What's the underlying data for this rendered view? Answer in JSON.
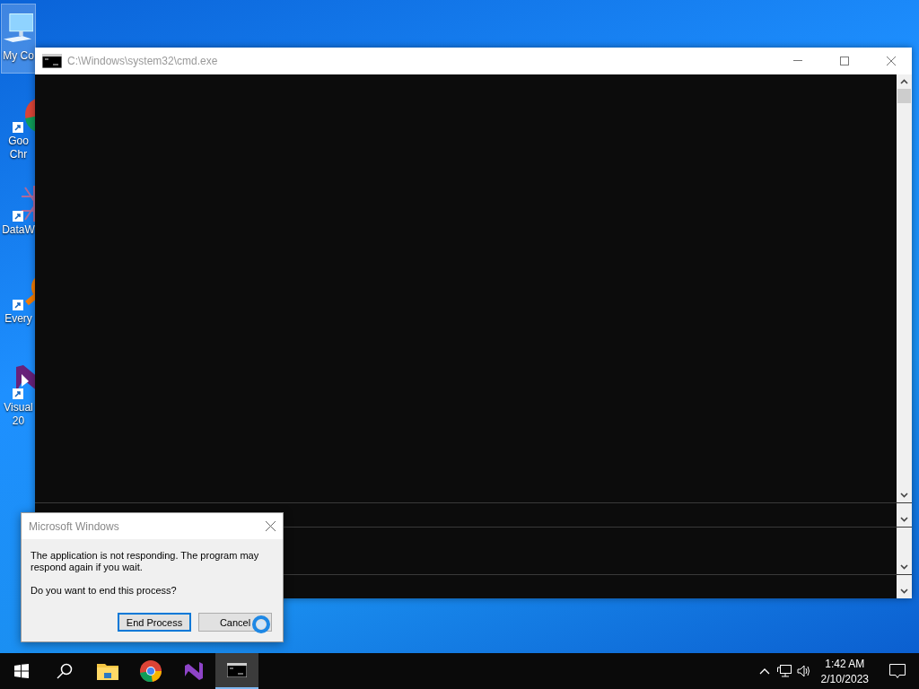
{
  "desktop_icons": [
    {
      "kind": "computer",
      "lines": [
        "My Co"
      ],
      "selected": true
    },
    {
      "kind": "chrome",
      "lines": [
        "Goo",
        "Chr"
      ],
      "selected": false
    },
    {
      "kind": "grid",
      "lines": [
        "DataW"
      ],
      "selected": false
    },
    {
      "kind": "magnifier",
      "lines": [
        "Every"
      ],
      "selected": false
    },
    {
      "kind": "studio",
      "lines": [
        "Visual",
        "20"
      ],
      "selected": false
    }
  ],
  "window": {
    "title": "C:\\Windows\\system32\\cmd.exe"
  },
  "dialog": {
    "title": "Microsoft Windows",
    "message": "The application is not responding. The program may respond again if you wait.",
    "question": "Do you want to end this process?",
    "buttons": [
      {
        "label": "End Process",
        "focused": true
      },
      {
        "label": "Cancel",
        "focused": false
      }
    ]
  },
  "taskbar": {
    "apps": [
      {
        "kind": "explorer",
        "active": false
      },
      {
        "kind": "chrome",
        "active": false
      },
      {
        "kind": "studio",
        "active": false
      },
      {
        "kind": "console",
        "active": true
      }
    ],
    "time": "1:42 AM",
    "date": "2/10/2023"
  }
}
